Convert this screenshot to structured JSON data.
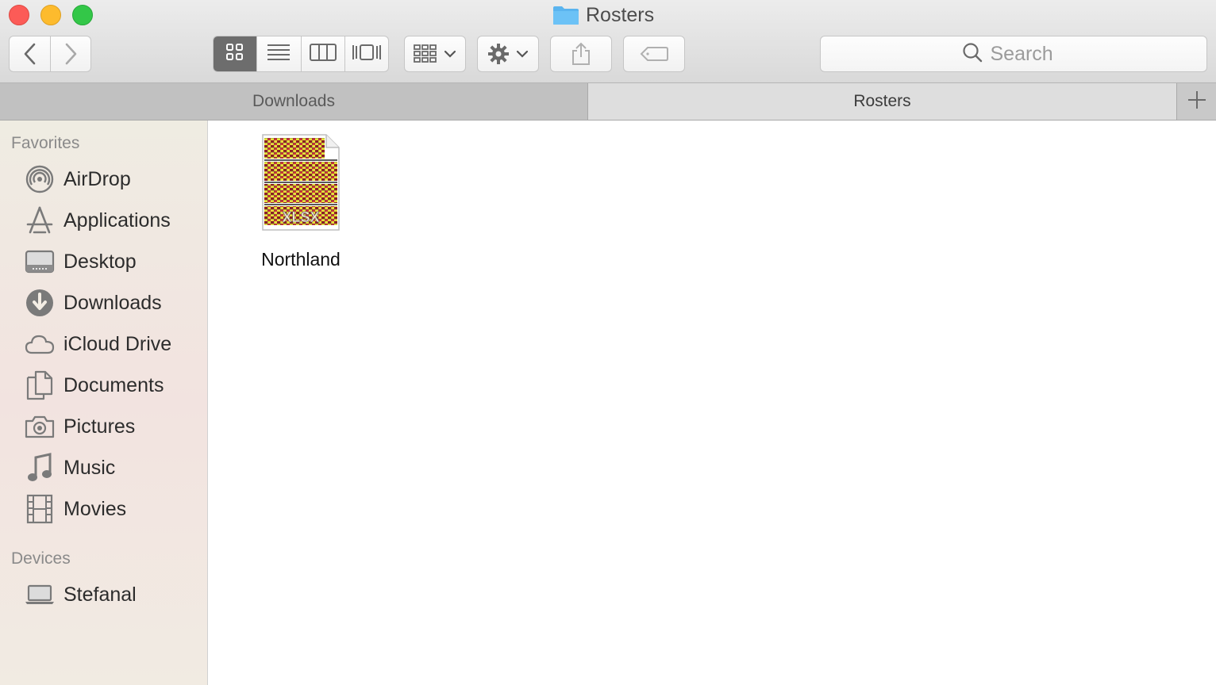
{
  "window": {
    "title": "Rosters",
    "title_icon": "folder-icon"
  },
  "toolbar": {
    "back_icon": "chevron-left-icon",
    "forward_icon": "chevron-right-icon",
    "view_modes": [
      {
        "name": "icon-view",
        "icon": "grid-icon",
        "active": true
      },
      {
        "name": "list-view",
        "icon": "list-icon",
        "active": false
      },
      {
        "name": "column-view",
        "icon": "columns-icon",
        "active": false
      },
      {
        "name": "cover-flow-view",
        "icon": "coverflow-icon",
        "active": false
      }
    ],
    "arrange_icon": "arrange-grid-icon",
    "action_icon": "gear-icon",
    "share_icon": "share-icon",
    "tags_icon": "tag-icon",
    "search": {
      "placeholder": "Search",
      "value": ""
    }
  },
  "tabs": [
    {
      "label": "Downloads",
      "active": false
    },
    {
      "label": "Rosters",
      "active": true
    }
  ],
  "sidebar": {
    "favorites_heading": "Favorites",
    "favorites": [
      {
        "label": "AirDrop",
        "icon": "airdrop-icon"
      },
      {
        "label": "Applications",
        "icon": "applications-icon"
      },
      {
        "label": "Desktop",
        "icon": "desktop-icon"
      },
      {
        "label": "Downloads",
        "icon": "downloads-icon"
      },
      {
        "label": "iCloud Drive",
        "icon": "cloud-icon"
      },
      {
        "label": "Documents",
        "icon": "documents-icon"
      },
      {
        "label": "Pictures",
        "icon": "camera-icon"
      },
      {
        "label": "Music",
        "icon": "music-note-icon"
      },
      {
        "label": "Movies",
        "icon": "film-icon"
      }
    ],
    "devices_heading": "Devices",
    "devices": [
      {
        "label": "Stefanal",
        "icon": "laptop-icon"
      }
    ]
  },
  "files": [
    {
      "name": "Northland",
      "badge": "XLSX",
      "icon": "spreadsheet-file-icon"
    }
  ],
  "colors": {
    "close": "#fc5b57",
    "minimize": "#fdbb2d",
    "maximize": "#33c748",
    "folder": "#5ab4ef",
    "active_view": "#6d6d6d"
  }
}
